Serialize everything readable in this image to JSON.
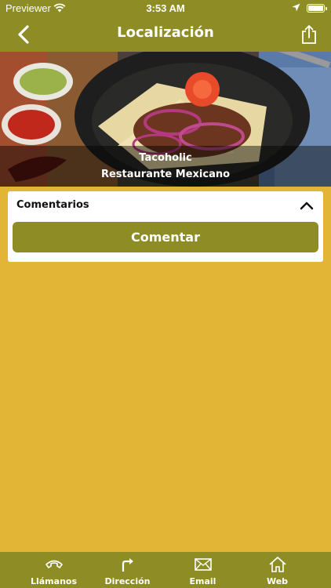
{
  "status_bar": {
    "carrier": "Previewer",
    "time": "3:53 AM"
  },
  "nav": {
    "title": "Localización",
    "icons": [
      "back-chevron-icon",
      "share-icon"
    ]
  },
  "hero": {
    "line1": "Tacoholic",
    "line2": "Restaurante Mexicano"
  },
  "comments": {
    "title": "Comentarios",
    "button_label": "Comentar"
  },
  "tabs": [
    {
      "label": "Llámanos",
      "icon": "phone-icon"
    },
    {
      "label": "Dirección",
      "icon": "turn-right-arrow-icon"
    },
    {
      "label": "Email",
      "icon": "envelope-icon"
    },
    {
      "label": "Web",
      "icon": "home-icon"
    }
  ],
  "colors": {
    "bar": "#8E8C24",
    "background": "#E2B536",
    "card": "#FFFFFF"
  }
}
